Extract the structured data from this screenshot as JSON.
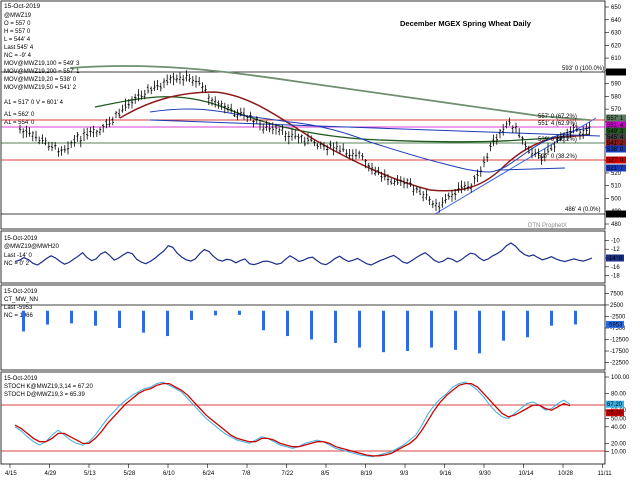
{
  "chart_data": {
    "title": "December MGEX Spring Wheat Daily",
    "watermark": "DTN ProphetX",
    "date_header": "15-Oct-2019",
    "type": "candlestick",
    "price_panel": {
      "symbol": "@MWZ19",
      "ohlc_labels": [
        "O = 557 0",
        "H = 557 0",
        "L = 544' 4",
        "Last 545' 4",
        "NC = -9' 4"
      ],
      "ma_labels": [
        "MOV@MWZ19,100 = 549' 3",
        "MOV@MWZ19,200 = 557' 1",
        "MOV@MWZ19,50 = 541' 2",
        "MOV@MWZ19,20 = 538' 0"
      ],
      "line_labels": [
        "A1 = 517' 0  V = 601' 4",
        "A1 = 562' 0",
        "A1 = 554' 0"
      ],
      "fib_labels": [
        "593' 0 (100.0%)",
        "557' 0 (67.2%)",
        "551' 4 (62.9%)",
        "539' 6 (50.2%)",
        "527' 0 (38.2%)",
        "486' 4 (0.0%)"
      ],
      "colors": {
        "ma20": "#1a3bb8",
        "ma50": "#8b1a1a",
        "ma100": "#1f5a1f",
        "ma200": "#5e7a5e",
        "magenta": "#cc00cc",
        "red": "#cc0000"
      },
      "ylim": [
        480,
        650
      ],
      "y_ticks": [
        "650",
        "640",
        "630",
        "620",
        "610",
        "600",
        "590",
        "580",
        "570",
        "560",
        "550",
        "540",
        "530",
        "520",
        "510",
        "500",
        "490",
        "480"
      ],
      "right_labels": [
        "593' 0",
        "557' 1",
        "551' 4",
        "549' 3",
        "545' 4",
        "541' 2",
        "538' 0",
        "527' 0",
        "521' 7",
        "486' 4"
      ]
    },
    "spread_panel": {
      "title": "@MWZ19@MWH20",
      "last": "Last -14' 0",
      "nc": "NC = 0' 2",
      "color": "#1a2e8a",
      "y_ticks": [
        "-10",
        "-12",
        "-14",
        "-16",
        "-18"
      ],
      "right_label": "-14' 0",
      "values": [
        -14.8,
        -14.5,
        -13.9,
        -14.4,
        -15.2,
        -15.6,
        -14.9,
        -14.1,
        -13.5,
        -14.0,
        -14.8,
        -15.4,
        -15.0,
        -14.3,
        -13.6,
        -12.8,
        -13.9,
        -14.6,
        -14.2,
        -13.1,
        -12.6,
        -13.4,
        -14.5,
        -14.0,
        -13.3,
        -12.7,
        -13.0,
        -14.3,
        -14.9,
        -15.3,
        -14.8,
        -14.1,
        -13.2,
        -12.4,
        -11.2,
        -11.6,
        -12.9,
        -13.8,
        -14.4,
        -14.7,
        -14.2,
        -13.0,
        -12.1,
        -12.5,
        -13.6,
        -14.4,
        -14.7,
        -14.3,
        -14.5,
        -15.1,
        -14.6,
        -14.2,
        -15.3,
        -15.5,
        -15.2,
        -14.8,
        -14.7,
        -15.0,
        -15.4,
        -15.2,
        -14.3,
        -13.5,
        -14.1,
        -14.8,
        -14.5,
        -14.0,
        -13.8,
        -14.6,
        -15.3,
        -15.5,
        -14.9,
        -14.1,
        -13.6,
        -14.3,
        -14.8,
        -14.5,
        -14.1,
        -14.7,
        -15.3,
        -15.6,
        -15.1,
        -14.6,
        -14.2,
        -13.8,
        -13.4,
        -14.1,
        -14.9,
        -15.2,
        -14.6,
        -13.9,
        -13.3,
        -12.8,
        -13.6,
        -14.5,
        -15.0,
        -14.7,
        -14.0,
        -14.3,
        -14.9,
        -14.4,
        -13.6,
        -12.9,
        -13.1,
        -14.0,
        -14.6,
        -14.2,
        -13.5,
        -13.0,
        -12.3,
        -11.2,
        -10.6,
        -11.3,
        -12.4,
        -13.2,
        -13.6,
        -13.3,
        -13.9,
        -14.4,
        -14.1,
        -13.7,
        -14.2,
        -14.6,
        -14.8,
        -14.5,
        -14.2,
        -14.5,
        -14.7,
        -14.4,
        -14.0
      ]
    },
    "cot_panel": {
      "title": "CT_MW_NN",
      "last": "Last -5953",
      "nc": "NC = 1966",
      "color": "#2e6be6",
      "y_ticks": [
        "7500",
        "2500",
        "-2500",
        "-7500",
        "-12500",
        "-17500",
        "-22500"
      ],
      "right_label": "-5953",
      "values": [
        -9000,
        -6000,
        -5500,
        -6500,
        -7500,
        -9500,
        -11000,
        -4000,
        -2000,
        -1800,
        -8500,
        -11000,
        -12500,
        -14000,
        -16000,
        -18000,
        -17500,
        -16000,
        -17000,
        -18500,
        -13000,
        -11500,
        -6500,
        -5953
      ]
    },
    "stoch_panel": {
      "title": "15-Oct-2019",
      "k_label": "STOCH K@MWZ19,3,14 = 67.20",
      "d_label": "STOCH D@MWZ19,3 = 65.39",
      "k_color": "#3ab0e0",
      "d_color": "#cc0000",
      "y_ticks": [
        "100.00",
        "80.00",
        "60.00",
        "50.00",
        "40.00",
        "20.00",
        "10.00"
      ],
      "right_labels": [
        "67.20",
        "65.39"
      ],
      "upper": 80,
      "lower": 20,
      "k": [
        40,
        35,
        28,
        22,
        18,
        22,
        30,
        36,
        30,
        24,
        20,
        18,
        22,
        30,
        40,
        50,
        58,
        66,
        72,
        78,
        82,
        86,
        88,
        92,
        94,
        90,
        86,
        82,
        74,
        66,
        58,
        50,
        44,
        38,
        32,
        28,
        24,
        22,
        20,
        24,
        28,
        26,
        22,
        18,
        16,
        14,
        16,
        20,
        22,
        24,
        22,
        18,
        14,
        12,
        10,
        8,
        6,
        5,
        4,
        6,
        8,
        10,
        14,
        18,
        24,
        30,
        42,
        56,
        66,
        74,
        80,
        88,
        92,
        94,
        90,
        84,
        76,
        66,
        58,
        52,
        50,
        56,
        62,
        68,
        70,
        66,
        60,
        62,
        68,
        72,
        67.2
      ],
      "d": [
        42,
        38,
        32,
        26,
        22,
        22,
        26,
        32,
        32,
        28,
        24,
        20,
        20,
        26,
        34,
        44,
        52,
        60,
        68,
        74,
        80,
        84,
        86,
        90,
        92,
        92,
        88,
        84,
        78,
        70,
        62,
        54,
        48,
        42,
        36,
        30,
        26,
        24,
        22,
        22,
        26,
        26,
        24,
        20,
        18,
        16,
        16,
        18,
        20,
        22,
        22,
        20,
        16,
        14,
        12,
        10,
        8,
        6,
        5,
        5,
        6,
        8,
        12,
        16,
        20,
        26,
        36,
        48,
        60,
        70,
        78,
        84,
        90,
        92,
        92,
        88,
        80,
        72,
        64,
        56,
        52,
        54,
        58,
        62,
        66,
        66,
        62,
        60,
        64,
        68,
        65.39
      ]
    },
    "x_ticks": [
      "4/15",
      "4/29",
      "5/13",
      "5/28",
      "6/10",
      "6/24",
      "7/8",
      "7/22",
      "8/5",
      "8/19",
      "9/3",
      "9/16",
      "9/30",
      "10/14",
      "10/28",
      "11/11"
    ]
  }
}
